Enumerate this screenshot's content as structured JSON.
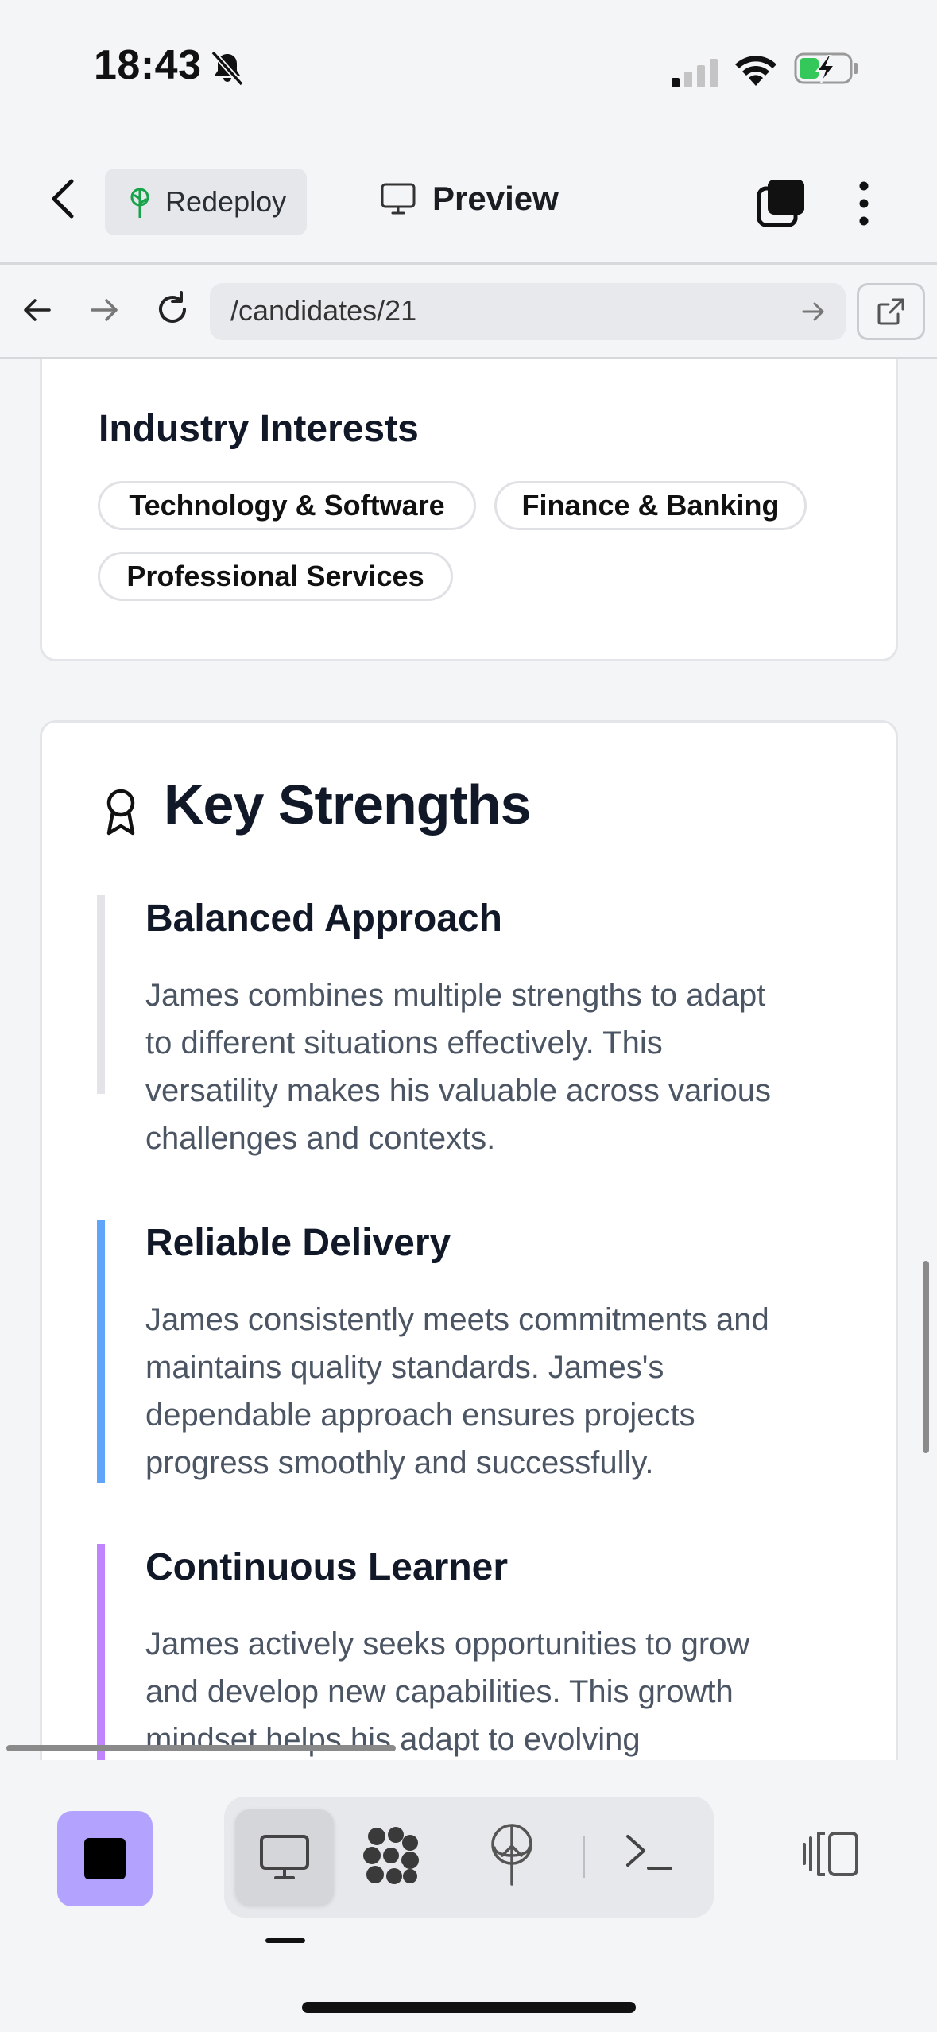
{
  "status_bar": {
    "time": "18:43"
  },
  "header": {
    "redeploy_label": "Redeploy",
    "preview_label": "Preview"
  },
  "browser": {
    "url": "/candidates/21"
  },
  "industry": {
    "title": "Industry Interests",
    "tags": [
      "Technology & Software",
      "Finance & Banking",
      "Professional Services"
    ]
  },
  "strengths": {
    "title": "Key Strengths",
    "items": [
      {
        "title": "Balanced Approach",
        "lines": [
          "James combines multiple strengths to adapt",
          "to different situations effectively. This",
          "versatility makes his valuable across various",
          "challenges and contexts."
        ],
        "accent": "#e3e4e7"
      },
      {
        "title": "Reliable Delivery",
        "lines": [
          "James consistently meets commitments and",
          "maintains quality standards. James's",
          "dependable approach ensures projects",
          "progress smoothly and successfully."
        ],
        "accent": "#60a5fa"
      },
      {
        "title": "Continuous Learner",
        "lines": [
          "James actively seeks opportunities to grow",
          "and develop new capabilities. This growth",
          "mindset helps his adapt to evolving"
        ],
        "accent": "#c084fc"
      }
    ]
  },
  "colors": {
    "stop_button": "#b3a3ff",
    "background": "#f4f5f7",
    "card": "#ffffff"
  },
  "icons": {
    "redeploy": "tree-icon",
    "preview": "monitor-icon",
    "award": "award-ribbon-icon"
  }
}
